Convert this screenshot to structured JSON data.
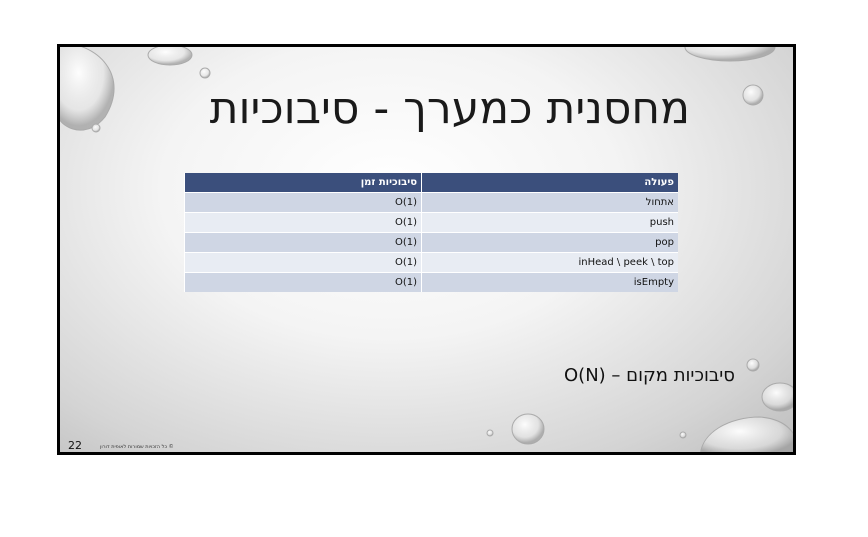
{
  "slide": {
    "title": "מחסנית כמערך - סיבוכיות",
    "table": {
      "headers": [
        "פעולה",
        "סיבוכיות זמן"
      ],
      "rows": [
        [
          "אתחול",
          "O(1)"
        ],
        [
          "push",
          "O(1)"
        ],
        [
          "pop",
          "O(1)"
        ],
        [
          "inHead \\ peek \\ top",
          "O(1)"
        ],
        [
          "isEmpty",
          "O(1)"
        ]
      ]
    },
    "space_complexity": "סיבוכיות מקום – O(N)",
    "footer": "© כל הזכויות שמורות לאופית דורון",
    "page_number": "22"
  },
  "colors": {
    "header_bg": "#3b4f7c",
    "row_odd": "#cfd6e4",
    "row_even": "#e8ecf3"
  }
}
